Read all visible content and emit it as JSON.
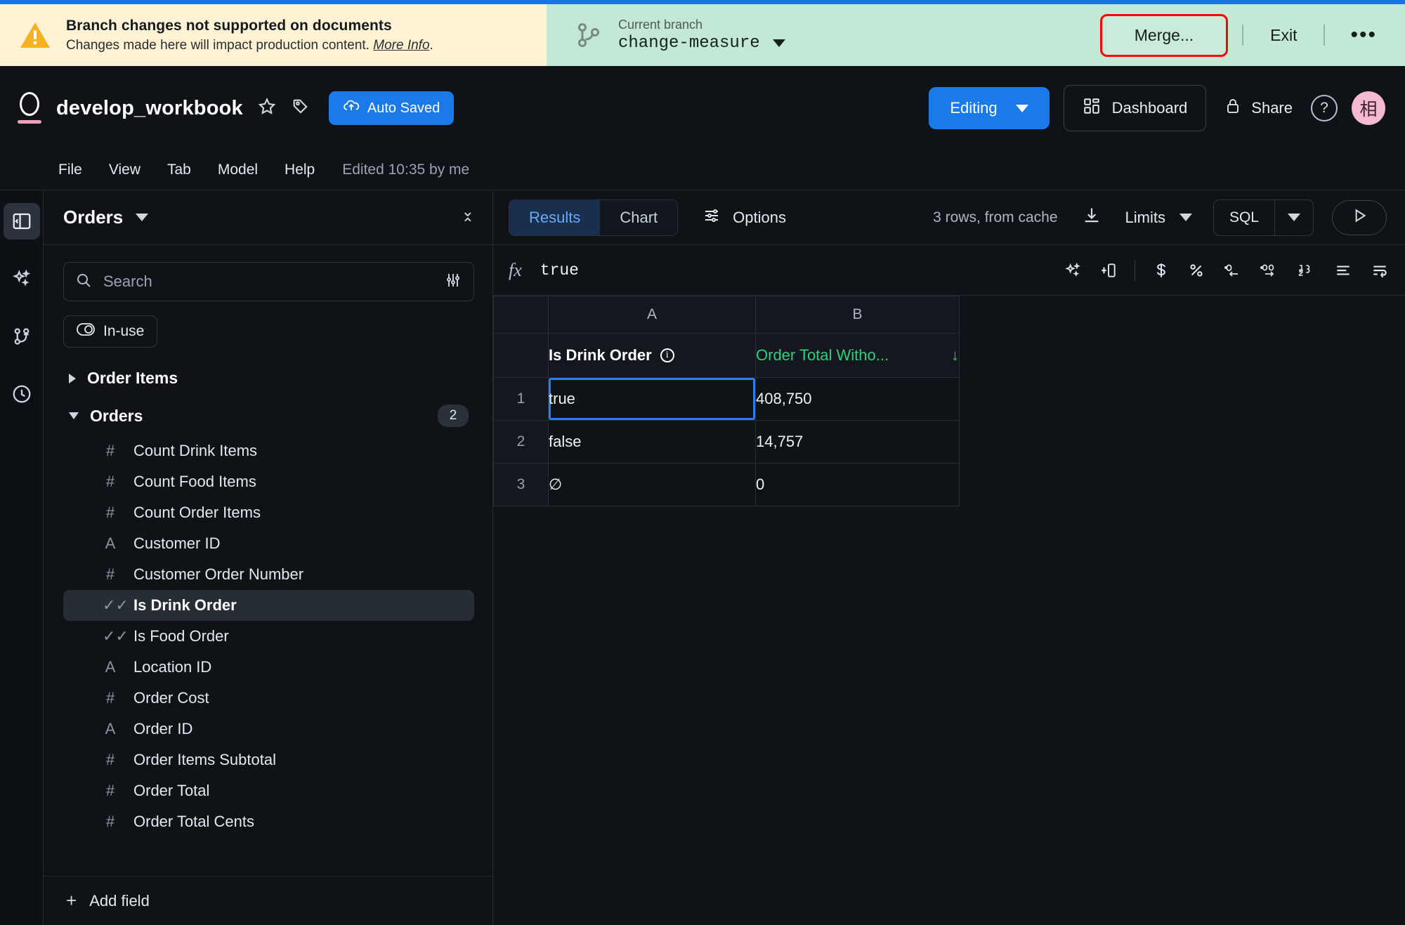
{
  "banner": {
    "icon": "warning-triangle-icon",
    "title": "Branch changes not supported on documents",
    "subtitle": "Changes made here will impact production content.",
    "link_text": "More Info",
    "link_suffix": ".",
    "bg_color": "#fdf2d3"
  },
  "branch_bar": {
    "icon": "git-branch-icon",
    "label": "Current branch",
    "name": "change-measure",
    "merge_label": "Merge...",
    "exit_label": "Exit",
    "more_label": "•••",
    "bg_color": "#c3e8d5",
    "highlight_color": "#ff0000"
  },
  "header": {
    "logo": "omni-logo-icon",
    "title": "develop_workbook",
    "star_icon": "star-icon",
    "tag_icon": "tag-icon",
    "autosaved_label": "Auto Saved",
    "autosaved_icon": "cloud-upload-icon",
    "editing_label": "Editing",
    "dashboard_label": "Dashboard",
    "dashboard_icon": "dashboard-grid-icon",
    "share_label": "Share",
    "share_icon": "lock-icon",
    "help_label": "?",
    "avatar_label": "相",
    "accent_color": "#1a7aea"
  },
  "menu": {
    "items": [
      "File",
      "View",
      "Tab",
      "Model",
      "Help"
    ],
    "edited_note": "Edited 10:35 by me"
  },
  "rail": {
    "items": [
      {
        "name": "collapse-panel-icon",
        "active": true
      },
      {
        "name": "sparkles-ai-icon",
        "active": false
      },
      {
        "name": "branch-icon",
        "active": false
      },
      {
        "name": "history-clock-icon",
        "active": false
      }
    ]
  },
  "sidebar": {
    "title": "Orders",
    "collapse_icon": "collapse-vertical-icon",
    "search": {
      "placeholder": "Search",
      "icon": "search-icon",
      "filter_icon": "filter-sliders-icon"
    },
    "inuse_chip": {
      "label": "In-use",
      "icon": "toggle-icon"
    },
    "groups": [
      {
        "name": "Order Items",
        "expanded": false,
        "badge": ""
      },
      {
        "name": "Orders",
        "expanded": true,
        "badge": "2"
      }
    ],
    "fields": [
      {
        "name": "Count Drink Items",
        "type": "#",
        "selected": false
      },
      {
        "name": "Count Food Items",
        "type": "#",
        "selected": false
      },
      {
        "name": "Count Order Items",
        "type": "#",
        "selected": false
      },
      {
        "name": "Customer ID",
        "type": "A",
        "selected": false
      },
      {
        "name": "Customer Order Number",
        "type": "#",
        "selected": false
      },
      {
        "name": "Is Drink Order",
        "type": "✓✓",
        "selected": true
      },
      {
        "name": "Is Food Order",
        "type": "✓✓",
        "selected": false
      },
      {
        "name": "Location ID",
        "type": "A",
        "selected": false
      },
      {
        "name": "Order Cost",
        "type": "#",
        "selected": false
      },
      {
        "name": "Order ID",
        "type": "A",
        "selected": false
      },
      {
        "name": "Order Items Subtotal",
        "type": "#",
        "selected": false
      },
      {
        "name": "Order Total",
        "type": "#",
        "selected": false
      },
      {
        "name": "Order Total Cents",
        "type": "#",
        "selected": false
      }
    ],
    "add_field_label": "Add field"
  },
  "results_toolbar": {
    "tabs": [
      {
        "label": "Results",
        "active": true
      },
      {
        "label": "Chart",
        "active": false
      }
    ],
    "options_label": "Options",
    "options_icon": "sliders-icon",
    "rows_note": "3 rows, from cache",
    "download_icon": "download-icon",
    "limits_label": "Limits",
    "sql_label": "SQL",
    "run_icon": "play-icon"
  },
  "formula_bar": {
    "fx_symbol": "fx",
    "value": "true",
    "tools": [
      "sparkles-format-icon",
      "insert-column-icon",
      "currency-dollar-icon",
      "percent-icon",
      "decrease-decimal-icon",
      "increase-decimal-icon",
      "number-format-icon",
      "align-icon",
      "wrap-text-icon"
    ]
  },
  "grid": {
    "column_letters": [
      "A",
      "B"
    ],
    "headers": [
      {
        "label": "Is Drink Order",
        "color": "#ffffff",
        "info_icon": "info-icon",
        "sorted": false
      },
      {
        "label": "Order Total Witho...",
        "color": "#2fcf7e",
        "info_icon": "",
        "sorted": true,
        "sort_arrow": "↓"
      }
    ],
    "rows": [
      {
        "num": "1",
        "cells": [
          "true",
          "408,750"
        ],
        "selected_cell": 0
      },
      {
        "num": "2",
        "cells": [
          "false",
          "14,757"
        ],
        "selected_cell": -1
      },
      {
        "num": "3",
        "cells": [
          "∅",
          "0"
        ],
        "selected_cell": -1
      }
    ]
  }
}
